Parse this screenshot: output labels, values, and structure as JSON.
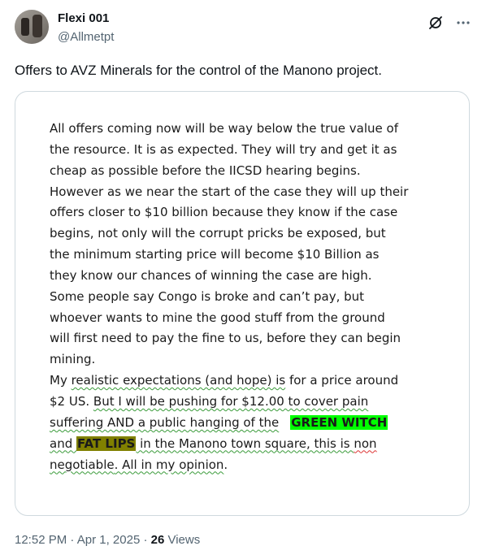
{
  "author": {
    "name": "Flexi 001",
    "handle": "@Allmetpt",
    "avatar_icon": "avatar-photo"
  },
  "header_actions": {
    "grok_icon": "grok-icon",
    "more_icon": "more-icon"
  },
  "tweet": {
    "text": "Offers to AVZ Minerals for the control of the Manono project."
  },
  "document": {
    "lines": [
      "All offers coming now will be way below the true value of",
      "the resource. It is as expected. They will try and get it as",
      "cheap as possible before the IICSD hearing begins.",
      "However as we near the start of the case they will up their",
      "offers closer to $10 billion because they know if the case",
      "begins, not only will the corrupt pricks be exposed, but",
      "the minimum starting price will become $10 Billion as",
      "they know our chances of winning the case are high.",
      "Some people say Congo is broke and can’t pay, but",
      "whoever wants to mine the good stuff from the ground",
      "will first need to pay the fine to us, before they can begin",
      "mining."
    ],
    "p2": {
      "l1a": "My ",
      "l1b": "realistic expectations (and hope) is",
      "l1c": " for a price around",
      "l2a": "$2 US. ",
      "l2b": "But I will be pushing for $12.00 to cover pain",
      "l3a": "suffering AND a public hanging of the",
      "l3b": "GREEN WITCH",
      "l4a": "and ",
      "l4b": "FAT LIPS",
      "l4c": " in the Manono town square, this is ",
      "l4d": "non",
      "l5a": "negotiable",
      "l5b": ". All in my opinion",
      "l5c": "."
    },
    "highlight_colors": {
      "green": "#00ff00",
      "olive": "#808000"
    }
  },
  "footer": {
    "time": "12:52 PM",
    "separator": " · ",
    "date": "Apr 1, 2025",
    "separator2": " · ",
    "views_count": "26",
    "views_label": " Views"
  }
}
